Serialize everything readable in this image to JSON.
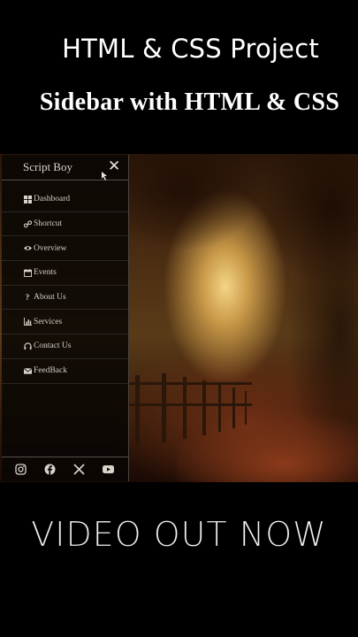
{
  "header": {
    "title": "HTML & CSS Project",
    "subtitle": "Sidebar with HTML & CSS"
  },
  "sidebar": {
    "brand": "Script Boy",
    "close_icon": "close-icon",
    "items": [
      {
        "label": "Dashboard",
        "icon": "windows-icon"
      },
      {
        "label": "Shortcut",
        "icon": "link-icon"
      },
      {
        "label": "Overview",
        "icon": "eye-icon"
      },
      {
        "label": "Events",
        "icon": "calendar-icon"
      },
      {
        "label": "About Us",
        "icon": "question-icon"
      },
      {
        "label": "Services",
        "icon": "bar-chart-icon"
      },
      {
        "label": "Contact Us",
        "icon": "headset-icon"
      },
      {
        "label": "FeedBack",
        "icon": "envelope-icon"
      }
    ],
    "social": [
      "instagram-icon",
      "facebook-icon",
      "x-icon",
      "youtube-icon"
    ]
  },
  "footer": {
    "text": "VIDEO OUT NOW"
  },
  "colors": {
    "background": "#000000",
    "sidebar_bg": "#080604",
    "text": "#ffffff"
  }
}
